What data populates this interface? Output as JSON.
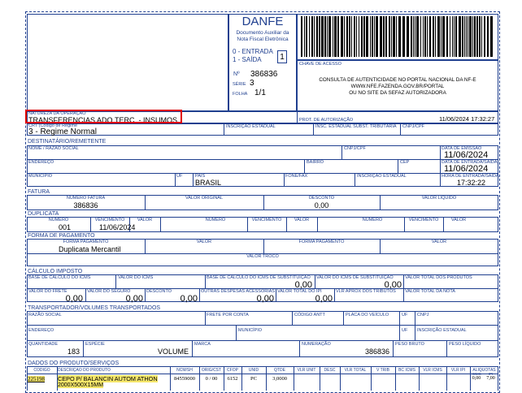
{
  "danfe": {
    "title": "DANFE",
    "subtitle_line1": "Documento Auxiliar da",
    "subtitle_line2": "Nota Fiscal Eletrônica",
    "entrada": "0 - ENTRADA",
    "saida": "1 - SAÍDA",
    "tipo": "1",
    "numero_label": "Nº",
    "numero": "386836",
    "serie_label": "SÉRIE",
    "serie": "3",
    "folha_label": "FOLHA",
    "folha": "1/1"
  },
  "chave": {
    "label": "CHAVE DE ACESSO",
    "consulta1": "CONSULTA DE AUTENTICIDADE NO PORTAL NACIONAL DA NF-E",
    "consulta2": "WWW.NFE.FAZENDA.GOV.BR/PORTAL",
    "consulta3": "OU NO SITE DA SEFAZ AUTORIZADORA"
  },
  "operacao": {
    "label": "NATUREZA DA OPERAÇÃO",
    "value": "TRANSFERENCIAS ADQ.TERC. - INSUMOS",
    "protocolo_label": "PROT. DE AUTORIZAÇÃO",
    "protocolo_value": "11/06/2024 17:32:27",
    "crt_label": "CRT (Código de Regime",
    "crt_value": "3 - Regime Normal",
    "ie_label": "INSCRIÇÃO ESTADUAL",
    "ie_st_label": "INSC. ESTADUAL SUBST. TRIBUTÁRIA",
    "cnpj_label": "CNPJ/CPF"
  },
  "destinatario": {
    "section": "DESTINATÁRIO/REMETENTE",
    "nome_label": "NOME / RAZÃO SOCIAL",
    "cnpj_label": "CNPJ/CPF",
    "emissao_label": "DATA DE EMISSÃO",
    "emissao_value": "11/06/2024",
    "endereco_label": "ENDEREÇO",
    "bairro_label": "BAIRRO",
    "cep_label": "CEP",
    "saida_label": "DATA DE ENTRADA/SAÍDA",
    "saida_value": "11/06/2024",
    "municipio_label": "MUNICÍPIO",
    "uf_label": "UF",
    "pais_label": "PAÍS",
    "pais_value": "BRASIL",
    "fone_label": "FONE/FAX",
    "ie_label": "INSCRIÇÃO ESTADUAL",
    "hora_label": "HORA DE ENTRADA/SAÍDA",
    "hora_value": "17:32:22"
  },
  "fatura": {
    "section": "FATURA",
    "numero_label": "NUMERO FATURA",
    "numero_value": "386836",
    "original_label": "VALOR ORIGINAL",
    "desconto_label": "DESCONTO",
    "desconto_value": "0,00",
    "liquido_label": "VALOR LIQUIDO"
  },
  "duplicata": {
    "section": "DUPLICATA",
    "numero_label": "NÚMERO",
    "venc_label": "VENCIMENTO",
    "valor_label": "VALOR",
    "numero_value": "001",
    "venc_value": "11/06/2024"
  },
  "pagamento": {
    "section": "FORMA DE PAGAMENTO",
    "forma_label": "FORMA PAGAMENTO",
    "valor_label": "VALOR",
    "forma_value": "Duplicata Mercantil",
    "troco_label": "VALOR TROCO"
  },
  "imposto": {
    "section": "CÁLCULO IMPOSTO",
    "bc_icms": "BASE DE CÁLCULO DO ICMS",
    "v_icms": "VALOR DO ICMS",
    "bc_st": "BASE DE CÁLCULO DO ICMS DE SUBSTITUIÇÃO",
    "bc_st_value": "0,00",
    "v_st": "VALOR DO ICMS DE SUBSTITUIÇÃO",
    "v_st_value": "0,00",
    "v_prod": "VALOR TOTAL DOS PRODUTOS",
    "frete": "VALOR DO FRETE",
    "frete_value": "0,00",
    "seguro": "VALOR DO SEGURO",
    "seguro_value": "0,00",
    "desconto": "DESCONTO",
    "desconto_value": "0,00",
    "outras": "OUTRAS DESPESAS ACESSÓRIAS",
    "outras_value": "0,00",
    "ipi": "VALOR TOTAL DO IPI",
    "ipi_value": "0,00",
    "aprox": "VLR APROX DOS TRIBUTOS",
    "total_nota": "VALOR TOTAL DA NOTA"
  },
  "transporte": {
    "section": "TRANSPORTADOR/VOLUMES TRANSPORTADOS",
    "razao": "RAZÃO SOCIAL",
    "frete_conta": "FRETE POR CONTA",
    "antt": "CÓDIGO ANTT",
    "placa": "PLACA DO VEÍCULO",
    "uf": "UF",
    "cnpj": "CNPJ",
    "endereco": "ENDEREÇO",
    "municipio": "MUNICÍPIO",
    "ie": "INSCRIÇÃO ESTADUAL",
    "quantidade": "QUANTIDADE",
    "quantidade_value": "183",
    "especie": "ESPÉCIE",
    "especie_value": "VOLUME",
    "marca": "MARCA",
    "numeracao": "NUMERAÇÃO",
    "numeracao_value": "386836",
    "peso_bruto": "PESO BRUTO",
    "peso_liquido": "PESO LÍQUIDO"
  },
  "produtos": {
    "section": "DADOS DO PRODUTO/SERVIÇOS",
    "headers": [
      "CÓDIGO",
      "DESCRIÇÃO DO PRODUTO",
      "NCM/SH",
      "ORIG/CST",
      "CFOP",
      "UNID",
      "QTDE",
      "VLR UNIT",
      "DESC",
      "VLR TOTAL",
      "V TRIB",
      "BC ICMS",
      "VLR ICMS",
      "VLR IPI",
      "ALIQUOTAS"
    ],
    "aliq_sub": [
      "ICMS",
      "IPI"
    ],
    "row": {
      "codigo": "225198",
      "descricao1": "CEPO P/ BALANCIN AUTOM ATHON",
      "descricao2": "2000X500X15MM",
      "ncm": "84559000",
      "cst": "0 / 00",
      "cfop": "6152",
      "unid": "PC",
      "qtde": "3,0000",
      "aliq_icms": "0,00",
      "aliq_ipi": "7,00"
    }
  },
  "colors": {
    "accent": "#1f3f8f",
    "highlight": "#f5e66a",
    "annotation": "#e00000"
  }
}
